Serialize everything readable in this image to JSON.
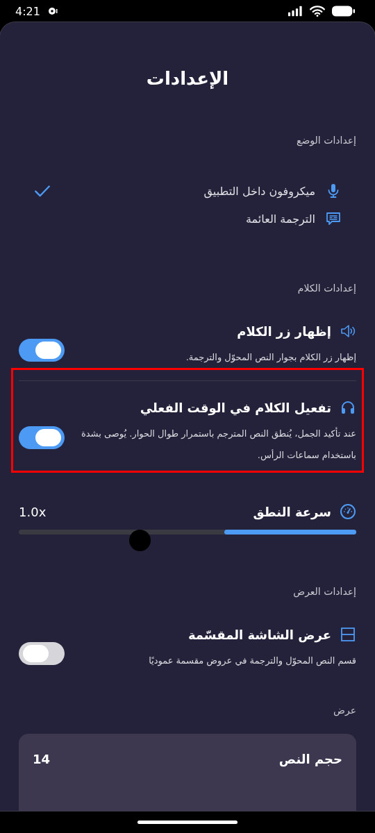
{
  "status_bar": {
    "time": "4:21"
  },
  "title": "الإعدادات",
  "mode_section": {
    "header": "إعدادات الوضع",
    "options": [
      {
        "label": "ميكروفون داخل التطبيق",
        "selected": true
      },
      {
        "label": "الترجمة العائمة",
        "selected": false
      }
    ]
  },
  "speech_section": {
    "header": "إعدادات الكلام",
    "toggles": [
      {
        "title": "إظهار زر الكلام",
        "description": "إظهار زر الكلام بجوار النص المحوّل والترجمة.",
        "on": true,
        "highlighted": false
      },
      {
        "title": "تفعيل الكلام في الوقت الفعلي",
        "description": "عند تأكيد الجمل، يُنطق النص المترجم باستمرار طوال الحوار. يُوصى بشدة باستخدام سماعات الرأس.",
        "on": true,
        "highlighted": true
      }
    ],
    "speed": {
      "label": "سرعة النطق",
      "value": "1.0x",
      "level": 0.39
    }
  },
  "display_section": {
    "header": "إعدادات العرض",
    "toggles": [
      {
        "title": "عرض الشاشة المقسّمة",
        "description": "قسم النص المحوّل والترجمة في عروض مقسمة عموديًا",
        "on": false,
        "highlighted": false
      }
    ]
  },
  "view_section": {
    "header": "عرض",
    "card": {
      "label": "حجم النص",
      "value": "14"
    }
  }
}
